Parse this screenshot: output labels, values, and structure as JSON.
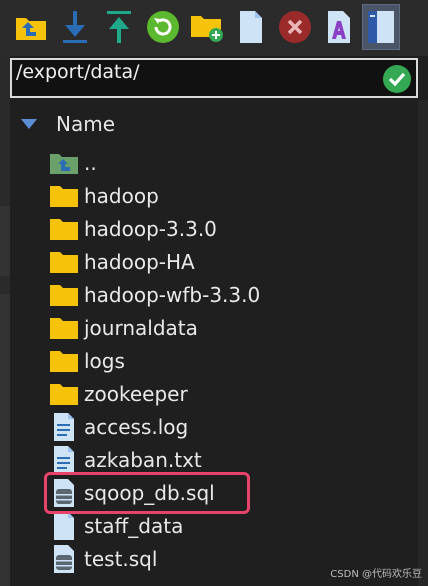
{
  "toolbar": {
    "buttons": [
      {
        "id": "up-folder",
        "icon": "folder-up-icon"
      },
      {
        "id": "download",
        "icon": "download-icon"
      },
      {
        "id": "upload",
        "icon": "upload-icon"
      },
      {
        "id": "refresh",
        "icon": "refresh-icon"
      },
      {
        "id": "new-folder",
        "icon": "new-folder-icon"
      },
      {
        "id": "new-file",
        "icon": "new-file-icon"
      },
      {
        "id": "delete",
        "icon": "delete-icon"
      },
      {
        "id": "rename",
        "icon": "rename-icon"
      },
      {
        "id": "toggle-panel",
        "icon": "panel-icon"
      }
    ]
  },
  "path": {
    "value": "/export/data/"
  },
  "header": {
    "name_label": "Name"
  },
  "files": [
    {
      "name": "..",
      "type": "parent"
    },
    {
      "name": "hadoop",
      "type": "folder"
    },
    {
      "name": "hadoop-3.3.0",
      "type": "folder"
    },
    {
      "name": "hadoop-HA",
      "type": "folder"
    },
    {
      "name": "hadoop-wfb-3.3.0",
      "type": "folder"
    },
    {
      "name": "journaldata",
      "type": "folder"
    },
    {
      "name": "logs",
      "type": "folder"
    },
    {
      "name": "zookeeper",
      "type": "folder"
    },
    {
      "name": "access.log",
      "type": "text"
    },
    {
      "name": "azkaban.txt",
      "type": "text"
    },
    {
      "name": "sqoop_db.sql",
      "type": "sql"
    },
    {
      "name": "staff_data",
      "type": "blank"
    },
    {
      "name": "test.sql",
      "type": "sql"
    }
  ],
  "watermark": "CSDN @代码欢乐豆",
  "colors": {
    "folder": "#f6c30a",
    "accent": "#2a6db5",
    "highlight": "#e8436a",
    "ok": "#34a853"
  }
}
